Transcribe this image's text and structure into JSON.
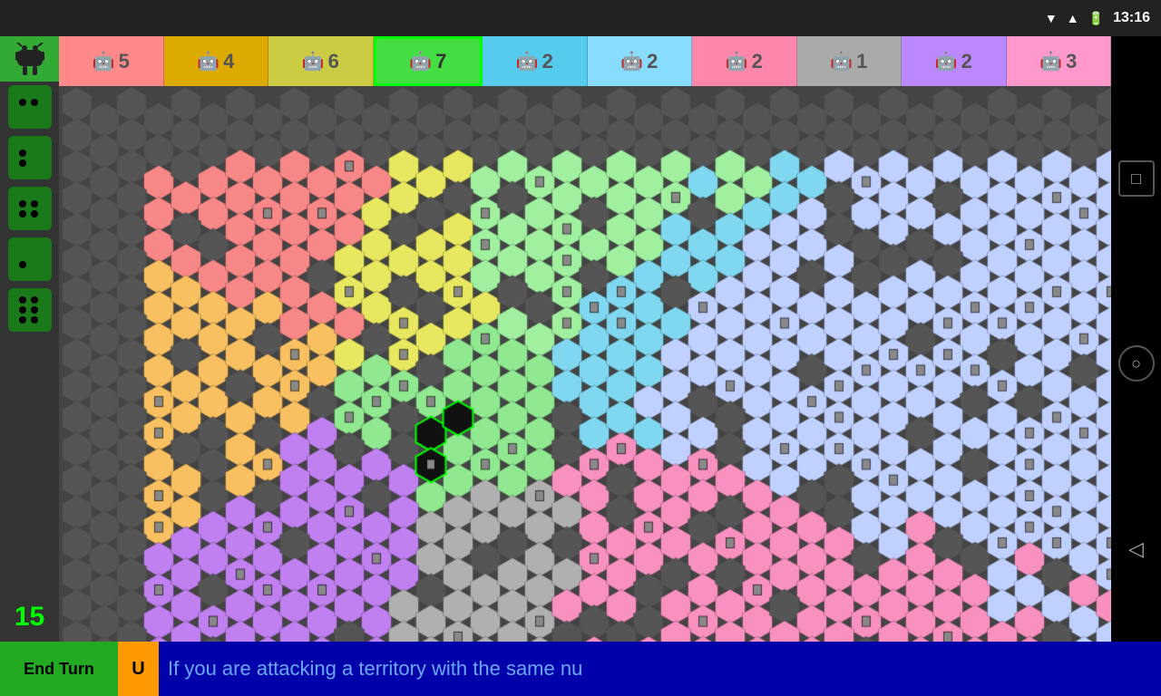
{
  "statusBar": {
    "time": "13:16",
    "icons": [
      "wifi",
      "signal",
      "battery"
    ]
  },
  "playerBar": {
    "players": [
      {
        "color": "#f88",
        "bg": "#f88",
        "count": 5,
        "active": false
      },
      {
        "color": "#da0",
        "bg": "#da0",
        "count": 4,
        "active": false
      },
      {
        "color": "#cc4",
        "bg": "#cc4",
        "count": 6,
        "active": false
      },
      {
        "color": "#4d4",
        "bg": "#4d4",
        "count": 7,
        "active": true
      },
      {
        "color": "#5ce",
        "bg": "#5ce",
        "count": 2,
        "active": false
      },
      {
        "color": "#8df",
        "bg": "#8df",
        "count": 2,
        "active": false
      },
      {
        "color": "#f8a",
        "bg": "#f8a",
        "count": 2,
        "active": false
      },
      {
        "color": "#aaa",
        "bg": "#aaa",
        "count": 1,
        "active": false
      },
      {
        "color": "#b8f",
        "bg": "#b8f",
        "count": 2,
        "active": false
      },
      {
        "color": "#f9c",
        "bg": "#f9c",
        "count": 3,
        "active": false
      }
    ]
  },
  "turnNumber": "15",
  "endTurnLabel": "End Turn",
  "undoLabel": "U",
  "message": "If you are attacking a territory with the same nu",
  "dice": [
    {
      "label": "d2",
      "dots": [
        1,
        1,
        0,
        0
      ]
    },
    {
      "label": "d3",
      "dots": [
        1,
        0,
        1,
        0
      ]
    },
    {
      "label": "d4",
      "dots": [
        1,
        1,
        1,
        1
      ]
    },
    {
      "label": "d1",
      "dots": [
        0,
        1,
        0,
        0
      ]
    },
    {
      "label": "d6",
      "dots": [
        1,
        1,
        1,
        1
      ]
    }
  ],
  "navButtons": [
    {
      "label": "□",
      "shape": "square"
    },
    {
      "label": "○",
      "shape": "circle"
    },
    {
      "label": "◁",
      "shape": "triangle"
    }
  ]
}
